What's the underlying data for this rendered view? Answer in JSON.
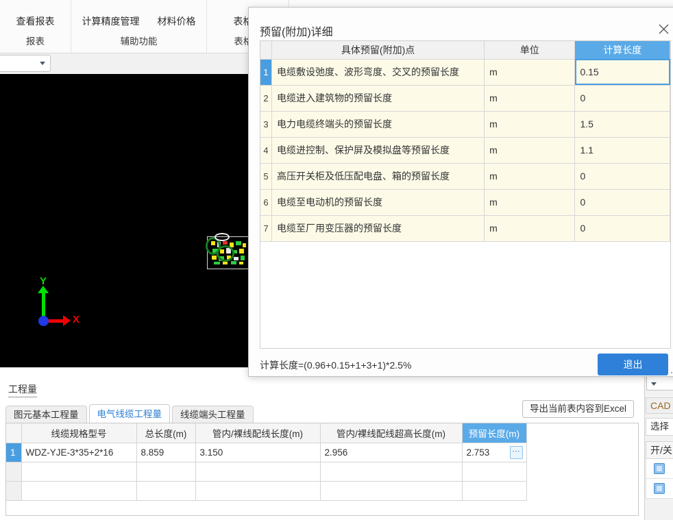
{
  "ribbon": {
    "groups": [
      {
        "label": "报表",
        "items": [
          "查看报表"
        ]
      },
      {
        "label": "辅助功能",
        "items": [
          "计算精度管理",
          "材料价格"
        ]
      },
      {
        "label": "表格算",
        "items": [
          "表格算"
        ]
      }
    ]
  },
  "viewport": {
    "axis": {
      "x_label": "X",
      "y_label": "Y"
    }
  },
  "bottom_panel": {
    "title": "工程量",
    "tabs": [
      {
        "label": "图元基本工程量",
        "active": false
      },
      {
        "label": "电气线缆工程量",
        "active": true
      },
      {
        "label": "线缆端头工程量",
        "active": false
      }
    ],
    "export_button": "导出当前表内容到Excel",
    "grid": {
      "headers": [
        "",
        "线缆规格型号",
        "总长度(m)",
        "管内/裸线配线长度(m)",
        "管内/裸线配线超高长度(m)",
        "预留长度(m)"
      ],
      "highlighted_header_index": 5,
      "rows": [
        {
          "num": "1",
          "cells": [
            "WDZ-YJE-3*35+2*16",
            "8.859",
            "3.150",
            "2.956",
            "2.753"
          ],
          "ellipsis_button": "⋯"
        }
      ]
    }
  },
  "right_dock": {
    "header": "CAD",
    "select_label": "选择",
    "section_label": "开/关"
  },
  "dialog": {
    "title": "预留(附加)详细",
    "close_icon": "close-icon",
    "headers": [
      "",
      "具体预留(附加)点",
      "单位",
      "计算长度"
    ],
    "highlighted_header_index": 3,
    "rows": [
      {
        "num": "1",
        "point": "电缆敷设弛度、波形弯度、交叉的预留长度",
        "unit": "m",
        "length": "0.15",
        "selected": true
      },
      {
        "num": "2",
        "point": "电缆进入建筑物的预留长度",
        "unit": "m",
        "length": "0",
        "selected": false
      },
      {
        "num": "3",
        "point": "电力电缆终端头的预留长度",
        "unit": "m",
        "length": "1.5",
        "selected": false
      },
      {
        "num": "4",
        "point": "电缆进控制、保护屏及模拟盘等预留长度",
        "unit": "m",
        "length": "1.1",
        "selected": false
      },
      {
        "num": "5",
        "point": "高压开关柜及低压配电盘、箱的预留长度",
        "unit": "m",
        "length": "0",
        "selected": false
      },
      {
        "num": "6",
        "point": "电缆至电动机的预留长度",
        "unit": "m",
        "length": "0",
        "selected": false
      },
      {
        "num": "7",
        "point": "电缆至厂用变压器的预留长度",
        "unit": "m",
        "length": "0",
        "selected": false
      }
    ],
    "formula": "计算长度=(0.96+0.15+1+3+1)*2.5%",
    "exit_button": "退出"
  },
  "colors": {
    "accent_blue": "#2f80d8",
    "header_highlight": "#5aaae8",
    "row_fill": "#fdfbe8",
    "tab_active_text": "#2d7fd3"
  }
}
